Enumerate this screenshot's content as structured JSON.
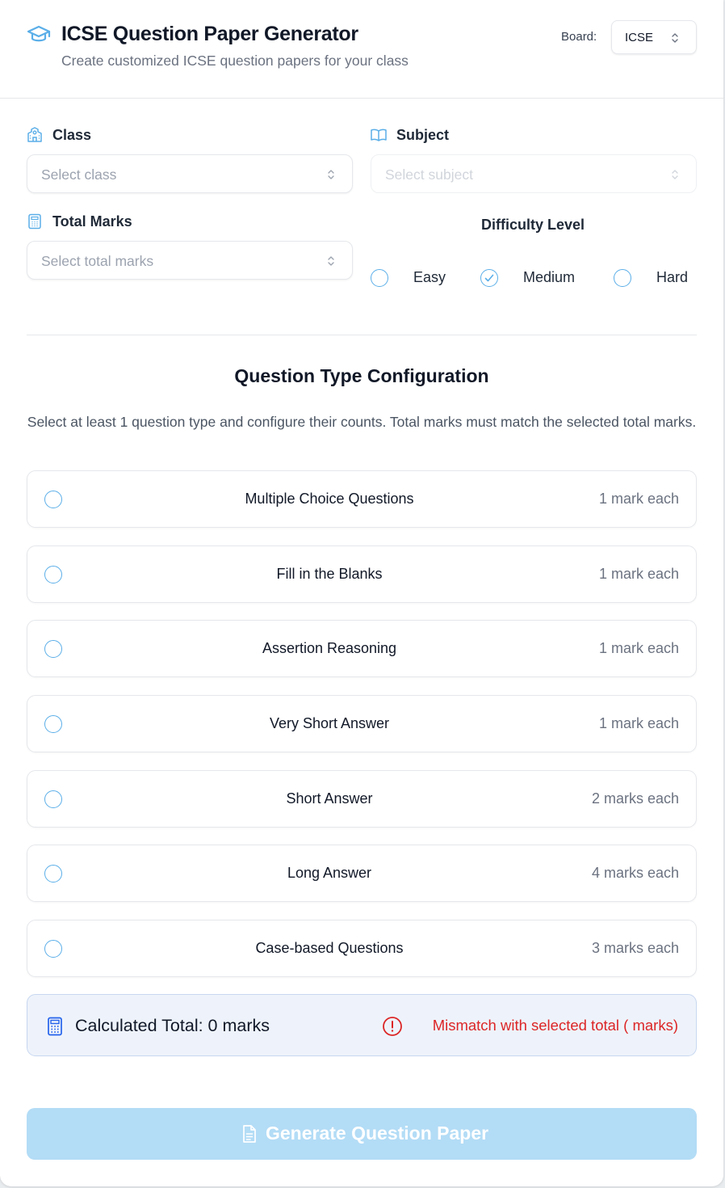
{
  "header": {
    "title": "ICSE Question Paper Generator",
    "subtitle": "Create customized ICSE question papers for your class",
    "board_label": "Board:",
    "board_value": "ICSE"
  },
  "form": {
    "class_label": "Class",
    "class_placeholder": "Select class",
    "subject_label": "Subject",
    "subject_placeholder": "Select subject",
    "marks_label": "Total Marks",
    "marks_placeholder": "Select total marks",
    "difficulty_label": "Difficulty Level",
    "difficulty_options": [
      {
        "label": "Easy",
        "selected": false
      },
      {
        "label": "Medium",
        "selected": true
      },
      {
        "label": "Hard",
        "selected": false
      }
    ]
  },
  "config": {
    "title": "Question Type Configuration",
    "description": "Select at least 1 question type and configure their counts. Total marks must match the selected total marks.",
    "types": [
      {
        "name": "Multiple Choice Questions",
        "marks": "1 mark each"
      },
      {
        "name": "Fill in the Blanks",
        "marks": "1 mark each"
      },
      {
        "name": "Assertion Reasoning",
        "marks": "1 mark each"
      },
      {
        "name": "Very Short Answer",
        "marks": "1 mark each"
      },
      {
        "name": "Short Answer",
        "marks": "2 marks each"
      },
      {
        "name": "Long Answer",
        "marks": "4 marks each"
      },
      {
        "name": "Case-based Questions",
        "marks": "3 marks each"
      }
    ]
  },
  "summary": {
    "total_text": "Calculated Total: 0 marks",
    "warning_text": "Mismatch with selected total ( marks)"
  },
  "actions": {
    "generate_label": "Generate Question Paper"
  },
  "colors": {
    "accent": "#5aaee8",
    "warning": "#dc2626",
    "button_disabled": "#b3dcf6",
    "summary_bg": "#eef3fb"
  }
}
